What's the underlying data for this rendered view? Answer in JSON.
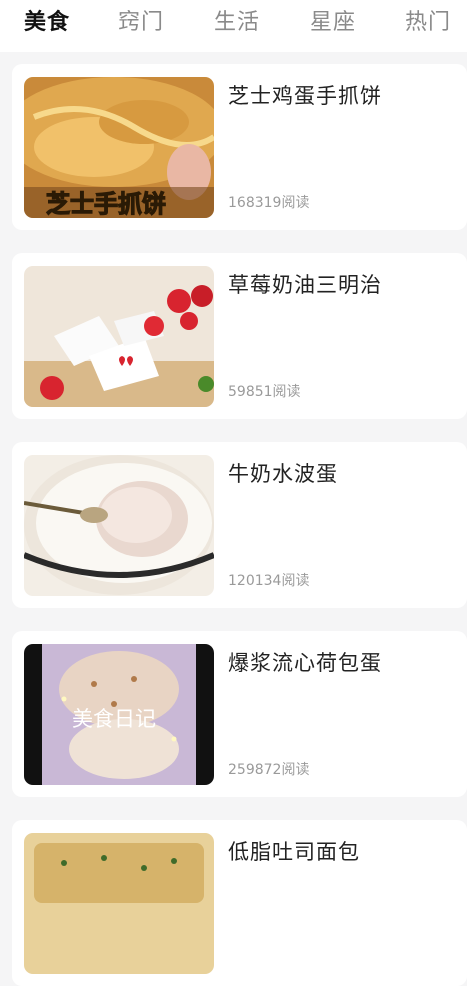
{
  "tabs": [
    {
      "label": "美食",
      "active": true
    },
    {
      "label": "窍门",
      "active": false
    },
    {
      "label": "生活",
      "active": false
    },
    {
      "label": "星座",
      "active": false
    },
    {
      "label": "热门",
      "active": false
    }
  ],
  "articles": [
    {
      "title": "芝士鸡蛋手抓饼",
      "reads": "168319阅读",
      "thumb_caption": "芝士手抓饼"
    },
    {
      "title": "草莓奶油三明治",
      "reads": "59851阅读",
      "thumb_caption": ""
    },
    {
      "title": "牛奶水波蛋",
      "reads": "120134阅读",
      "thumb_caption": ""
    },
    {
      "title": "爆浆流心荷包蛋",
      "reads": "259872阅读",
      "thumb_caption": "美食日记"
    },
    {
      "title": "低脂吐司面包",
      "reads": "",
      "thumb_caption": ""
    }
  ],
  "colors": {
    "active_tab": "#111111",
    "inactive_tab": "#8a8a8a",
    "background": "#f5f5f6"
  }
}
